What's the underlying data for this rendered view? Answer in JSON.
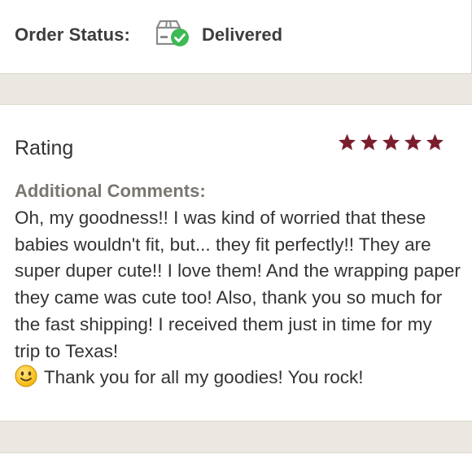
{
  "order": {
    "status_label": "Order Status:",
    "status_value": "Delivered",
    "status_icon": "package-delivered-icon",
    "check_color": "#3cba54"
  },
  "review": {
    "rating_label": "Rating",
    "stars": 5,
    "star_color": "#7a1e2e",
    "comments_heading": "Additional Comments:",
    "comments_emoji": "slightly-smiling-face-icon",
    "comments_before": "Oh, my goodness!! I was kind of worried that these babies wouldn't fit, but... they fit perfectly!! They are super duper cute!! I love them! And the wrapping paper they came was cute too! Also, thank you so much for the fast shipping! I received them just in time for my trip to Texas!",
    "comments_after": " Thank you for all my goodies! You rock!"
  }
}
